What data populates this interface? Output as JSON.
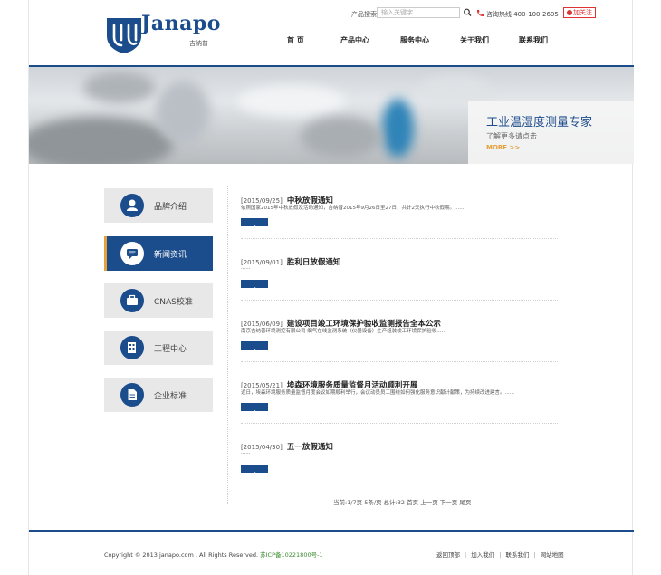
{
  "header": {
    "brand_name": "Janapo",
    "brand_sub": "吉纳普",
    "search_label": "产品搜索",
    "search_placeholder": "输入关键字",
    "hotline": "咨询热线 400-100-2605",
    "follow_label": "加关注",
    "nav": [
      "首 页",
      "产品中心",
      "服务中心",
      "关于我们",
      "联系我们"
    ],
    "accent_color": "#1b4c8c",
    "highlight_color": "#e7a03c"
  },
  "banner": {
    "title": "工业温湿度测量专家",
    "subtitle": "了解更多请点击",
    "more": "MORE >>"
  },
  "sidebar": {
    "items": [
      {
        "label": "品牌介绍",
        "icon": "person-icon",
        "active": false
      },
      {
        "label": "新闻资讯",
        "icon": "chat-icon",
        "active": true
      },
      {
        "label": "CNAS校准",
        "icon": "briefcase-icon",
        "active": false
      },
      {
        "label": "工程中心",
        "icon": "building-icon",
        "active": false
      },
      {
        "label": "企业标准",
        "icon": "document-icon",
        "active": false
      }
    ]
  },
  "news": [
    {
      "date": "[2015/09/25]",
      "title": "中秋放假通知",
      "desc": "依照国家2015年中秋放假及活动通知，吉纳普2015年9月26日至27日，共计2天执行中秋假期。......"
    },
    {
      "date": "[2015/09/01]",
      "title": "胜利日放假通知",
      "desc": "......"
    },
    {
      "date": "[2015/06/09]",
      "title": "建设项目竣工环境保护验收监测报告全本公示",
      "desc": "南京吉纳普环境测控有限公司 烟气在线监测系统（仪器设备）生产组装竣工环境保护验收......"
    },
    {
      "date": "[2015/05/21]",
      "title": "埃森环境服务质量监督月活动顺利开展",
      "desc": "近日，埃森环境服务质量监督月度会议如期顺利举行，会议动员员工围绕如何强化服务意识献计献策，为持续改进建言。......"
    },
    {
      "date": "[2015/04/30]",
      "title": "五一放假通知",
      "desc": "......"
    }
  ],
  "pager": "当前:1/7页 5条/页 总计:32  首页 上一页 下一页 尾页",
  "footer": {
    "copyright": "Copyright © 2013 janapo.com , All Rights Reserved.",
    "icp": "苏ICP备10221800号-1",
    "links": [
      "返回顶部",
      "加入我们",
      "联系我们",
      "网站地图"
    ]
  }
}
